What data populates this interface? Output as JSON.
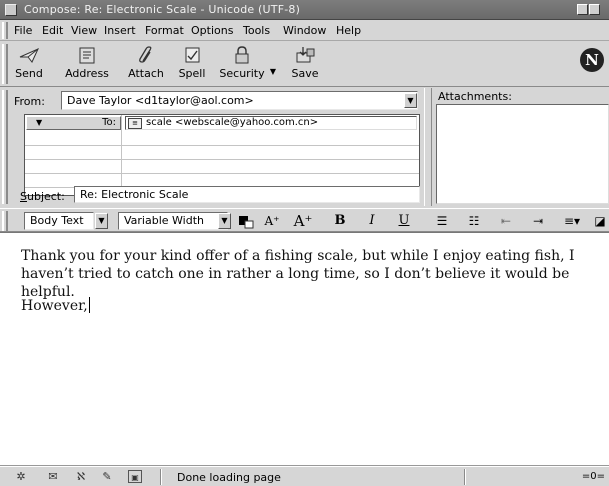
{
  "window": {
    "title": "Compose: Re: Electronic Scale - Unicode (UTF-8)"
  },
  "menu": [
    "File",
    "Edit",
    "View",
    "Insert",
    "Format",
    "Options",
    "Tools",
    "Window",
    "Help"
  ],
  "toolbar": {
    "send": "Send",
    "address": "Address",
    "attach": "Attach",
    "spell": "Spell",
    "security": "Security",
    "save": "Save"
  },
  "header": {
    "from_label": "From:",
    "from_value": "Dave Taylor <d1taylor@aol.com>",
    "to_type": "To:",
    "to_value": "scale <webscale@yahoo.com.cn>",
    "subject_label": "Subject:",
    "subject_value": "Re: Electronic Scale",
    "attachments_label": "Attachments:"
  },
  "format": {
    "paragraph_style": "Body Text",
    "font": "Variable Width",
    "bold": "B",
    "italic": "I",
    "underline": "U"
  },
  "body": {
    "paragraph1": "Thank you for your kind offer of a fishing scale, but while I enjoy eating fish, I haven’t tried to catch one in rather a long time, so I don’t believe it would be helpful.",
    "paragraph2": "However,"
  },
  "status": {
    "text": "Done loading page"
  },
  "icons": {
    "send": "send-icon",
    "address": "address-book-icon",
    "attach": "paperclip-icon",
    "spell": "spellcheck-icon",
    "security": "lock-icon",
    "save": "save-icon",
    "logo": "netscape-logo"
  }
}
